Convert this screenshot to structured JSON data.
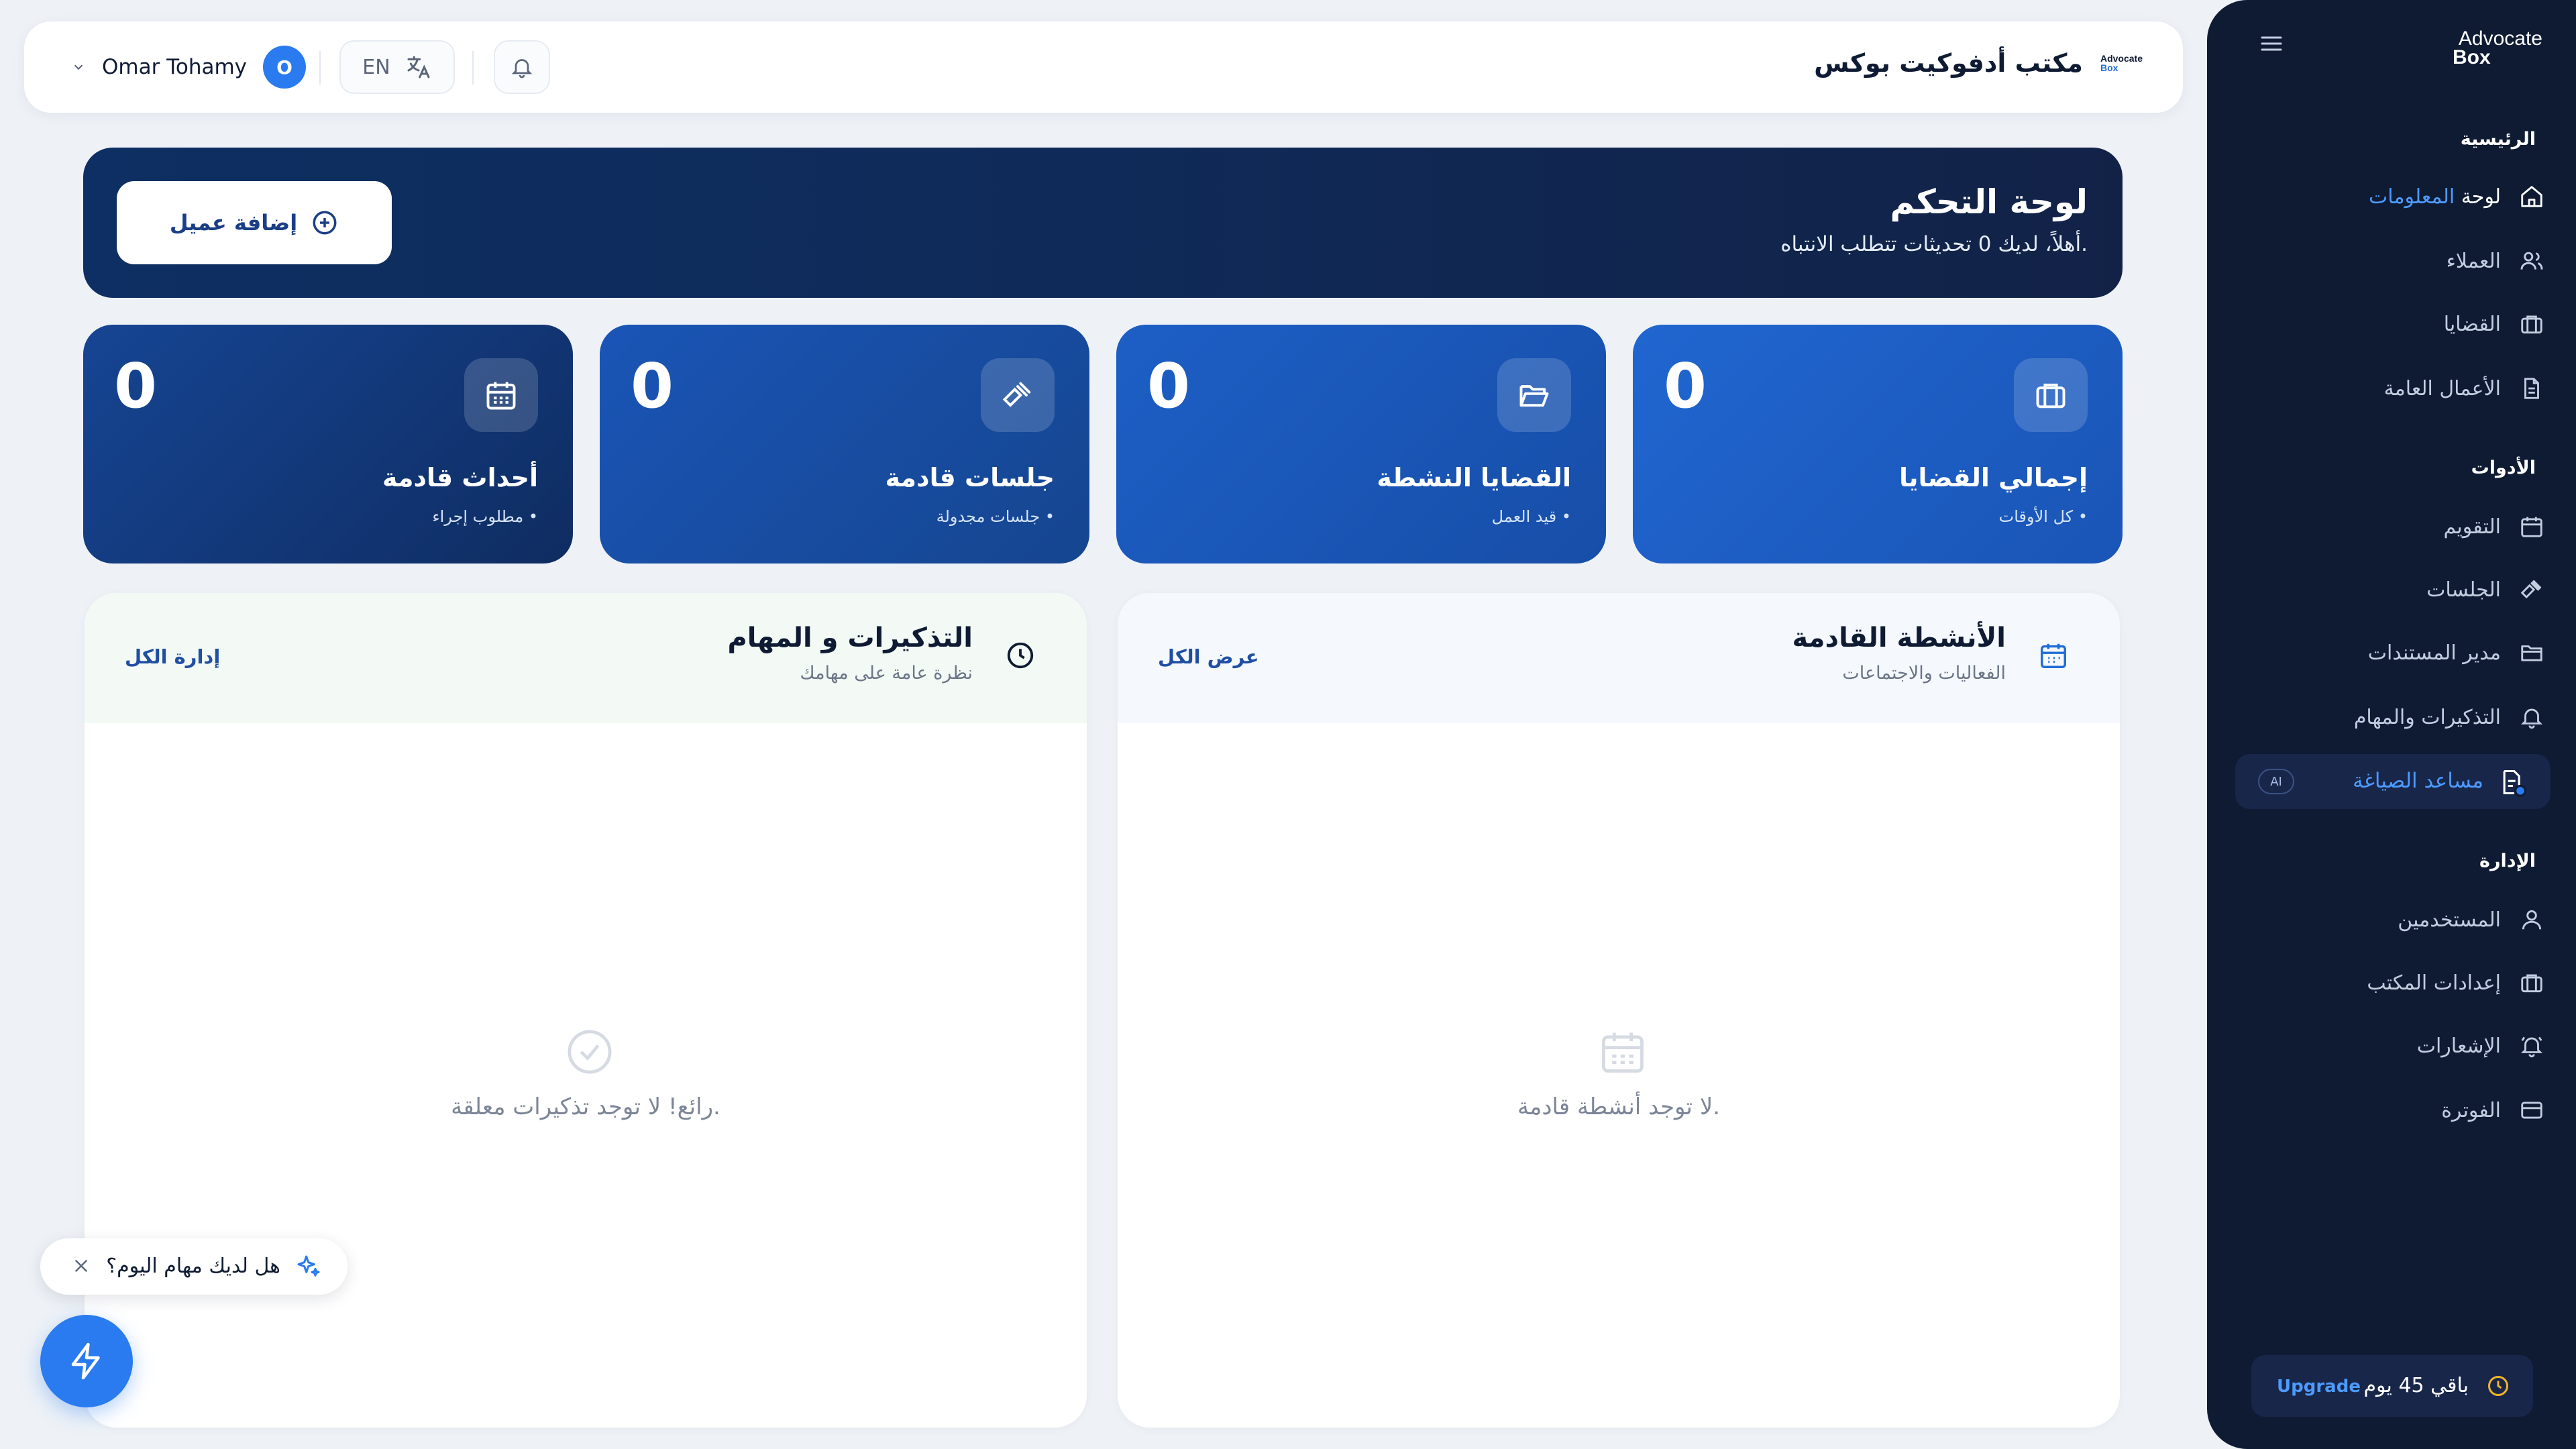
{
  "sidebar": {
    "brand_line1": "Advocate",
    "brand_line2": "Box",
    "sections": {
      "main": "الرئيسية",
      "tools": "الأدوات",
      "admin": "الإدارة"
    },
    "items": [
      {
        "label_pre": "لوحة ",
        "label_hl": "المعلومات",
        "icon": "home-icon"
      },
      {
        "label": "العملاء",
        "icon": "users-icon"
      },
      {
        "label": "القضايا",
        "icon": "briefcase-icon"
      },
      {
        "label": "الأعمال العامة",
        "icon": "document-icon"
      },
      {
        "label": "التقويم",
        "icon": "calendar-icon"
      },
      {
        "label": "الجلسات",
        "icon": "gavel-icon"
      },
      {
        "label": "مدير المستندات",
        "icon": "folder-icon"
      },
      {
        "label": "التذكيرات والمهام",
        "icon": "bell-icon"
      },
      {
        "label": "مساعد الصياغة",
        "badge": "AI",
        "icon": "ai-document-icon"
      },
      {
        "label": "المستخدمين",
        "icon": "user-icon"
      },
      {
        "label": "إعدادات المكتب",
        "icon": "building-icon"
      },
      {
        "label": "الإشعارات",
        "icon": "bell-ring-icon"
      },
      {
        "label": "الفوترة",
        "icon": "credit-card-icon"
      }
    ],
    "trial": {
      "days_left": "باقي 45 يوم",
      "upgrade": "Upgrade"
    }
  },
  "header": {
    "office_name": "مكتب أدفوكيت بوكس",
    "mini_logo_1": "Advocate",
    "mini_logo_2": "Box",
    "user_name": "Omar Tohamy",
    "avatar_initial": "O",
    "language": "EN"
  },
  "banner": {
    "title": "لوحة التحكم",
    "subtitle": "أهلاً، لديك 0 تحديثات تتطلب الانتباه.",
    "add_client": "إضافة عميل"
  },
  "stats": [
    {
      "value": "0",
      "title": "إجمالي القضايا",
      "sub": "كل الأوقات",
      "icon": "briefcase-icon"
    },
    {
      "value": "0",
      "title": "القضايا النشطة",
      "sub": "قيد العمل",
      "icon": "folder-open-icon"
    },
    {
      "value": "0",
      "title": "جلسات قادمة",
      "sub": "جلسات مجدولة",
      "icon": "gavel-icon"
    },
    {
      "value": "0",
      "title": "أحداث قادمة",
      "sub": "مطلوب إجراء",
      "icon": "calendar-icon"
    }
  ],
  "panels": {
    "activities": {
      "title": "الأنشطة القادمة",
      "subtitle": "الفعاليات والاجتماعات",
      "link": "عرض الكل",
      "empty": "لا توجد أنشطة قادمة."
    },
    "reminders": {
      "title": "التذكيرات و المهام",
      "subtitle": "نظرة عامة على مهامك",
      "link": "إدارة الكل",
      "empty": "رائع! لا توجد تذكيرات معلقة."
    }
  },
  "hint": {
    "text": "هل لديك مهام اليوم؟"
  },
  "colors": {
    "primary": "#2a7af0",
    "sidebar": "#0f1b33",
    "accent_text": "#4d9bff",
    "banner": "#0e2f63"
  }
}
